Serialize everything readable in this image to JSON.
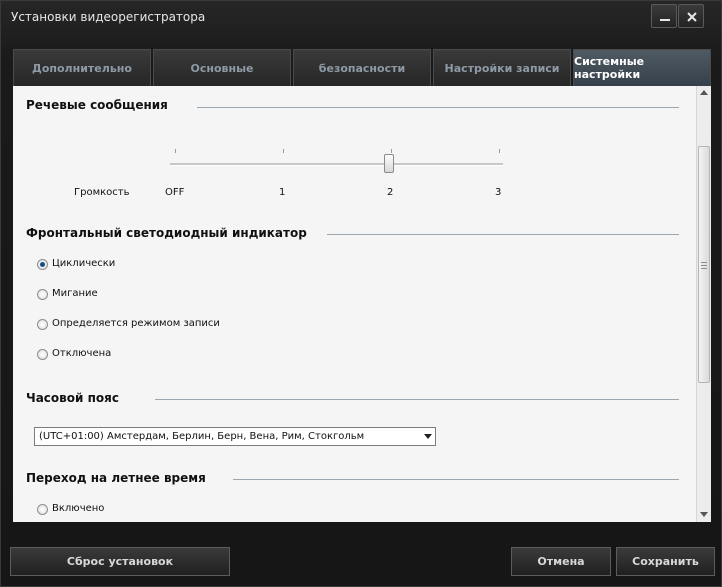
{
  "window": {
    "title": "Установки видеорегистратора"
  },
  "tabs": [
    {
      "label": "Дополнительно"
    },
    {
      "label": "Основные"
    },
    {
      "label": "безопасности"
    },
    {
      "label": "Настройки записи"
    },
    {
      "label": "Системные настройки",
      "active": true
    }
  ],
  "voice": {
    "section_title": "Речевые сообщения",
    "volume_label": "Громкость",
    "ticks": [
      "OFF",
      "1",
      "2",
      "3"
    ],
    "selected_value": "2"
  },
  "led": {
    "section_title": "Фронтальный светодиодный индикатор",
    "options": [
      {
        "label": "Циклически",
        "checked": true
      },
      {
        "label": "Мигание",
        "checked": false
      },
      {
        "label": "Определяется режимом записи",
        "checked": false
      },
      {
        "label": "Отключена",
        "checked": false
      }
    ]
  },
  "timezone": {
    "section_title": "Часовой пояс",
    "selected": "(UTC+01:00) Амстердам, Берлин, Берн, Вена, Рим, Стокгольм"
  },
  "dst": {
    "section_title": "Переход на летнее время",
    "options": [
      {
        "label": "Включено",
        "checked": false
      }
    ]
  },
  "buttons": {
    "reset": "Сброс установок",
    "cancel": "Отмена",
    "save": "Сохранить"
  },
  "colors": {
    "active_tab": "#4f5a63",
    "accent_radio": "#1a4c8a",
    "window_bg": "#1b1b1b"
  }
}
